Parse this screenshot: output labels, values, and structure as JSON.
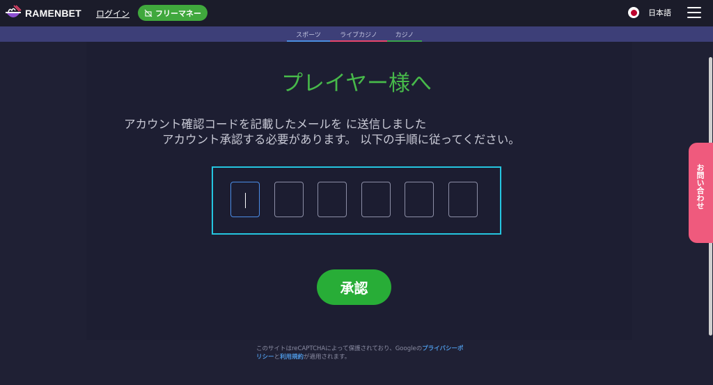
{
  "header": {
    "logo_text": "RAMENBET",
    "login_label": "ログイン",
    "free_money_label": "フリーマネー",
    "language_label": "日本語",
    "menu_icon": "hamburger-menu-icon",
    "flag_icon": "japan-flag-icon"
  },
  "subnav": {
    "items": [
      {
        "label": "スポーツ",
        "color": "#4a8fe0"
      },
      {
        "label": "ライブカジノ",
        "color": "#e9466b"
      },
      {
        "label": "カジノ",
        "color": "#3aa64a"
      }
    ]
  },
  "main": {
    "title": "プレイヤー様へ",
    "message_line1": "アカウント確認コードを記載したメールを に送信しました",
    "message_line2": "アカウント承認する必要があります。 以下の手順に従ってください。",
    "code_cells": [
      "",
      "",
      "",
      "",
      "",
      ""
    ],
    "confirm_label": "承認"
  },
  "recaptcha": {
    "prefix": "このサイトはreCAPTCHAによって保護されており、Googleの",
    "privacy_link": "プライバシーポリシー",
    "middle": "と",
    "terms_link": "利用規約",
    "suffix": "が適用されます。"
  },
  "contact": {
    "label": "お問い合わせ"
  },
  "colors": {
    "accent_green": "#47b94a",
    "button_green": "#28ad37",
    "code_box_border": "#25c6e0",
    "contact_pink": "#ef5a7d",
    "subnav_bg": "#3d3f78"
  }
}
